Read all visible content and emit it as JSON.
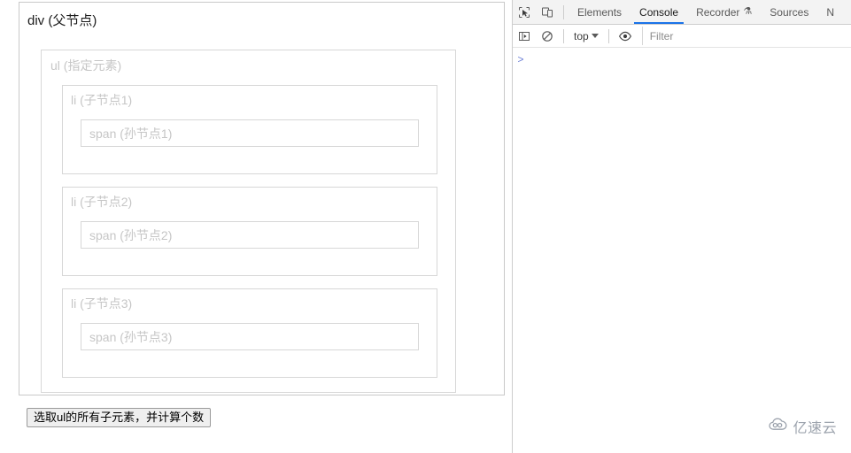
{
  "page": {
    "div_label": "div (父节点)",
    "ul_label": "ul (指定元素)",
    "items": [
      {
        "li_label": "li (子节点1)",
        "span_label": "span (孙节点1)"
      },
      {
        "li_label": "li (子节点2)",
        "span_label": "span (孙节点2)"
      },
      {
        "li_label": "li (子节点3)",
        "span_label": "span (孙节点3)"
      }
    ],
    "button_label": "选取ul的所有子元素，并计算个数"
  },
  "devtools": {
    "icons": {
      "inspect": "inspect-element-icon",
      "device": "device-toolbar-icon",
      "sidebar": "console-sidebar-icon",
      "clear": "clear-console-icon",
      "eye": "live-expression-eye-icon"
    },
    "tabs": [
      {
        "label": "Elements",
        "active": false,
        "flask": false
      },
      {
        "label": "Console",
        "active": true,
        "flask": false
      },
      {
        "label": "Recorder",
        "active": false,
        "flask": true
      },
      {
        "label": "Sources",
        "active": false,
        "flask": false
      },
      {
        "label": "N",
        "active": false,
        "flask": false
      }
    ],
    "flask_glyph": "⚗",
    "context_selector": "top",
    "filter_placeholder": "Filter",
    "prompt_symbol": ">",
    "prompt_value": ""
  },
  "watermark": {
    "text": "亿速云",
    "icon": "cloud-logo-icon",
    "color": "#9ca3ad"
  }
}
